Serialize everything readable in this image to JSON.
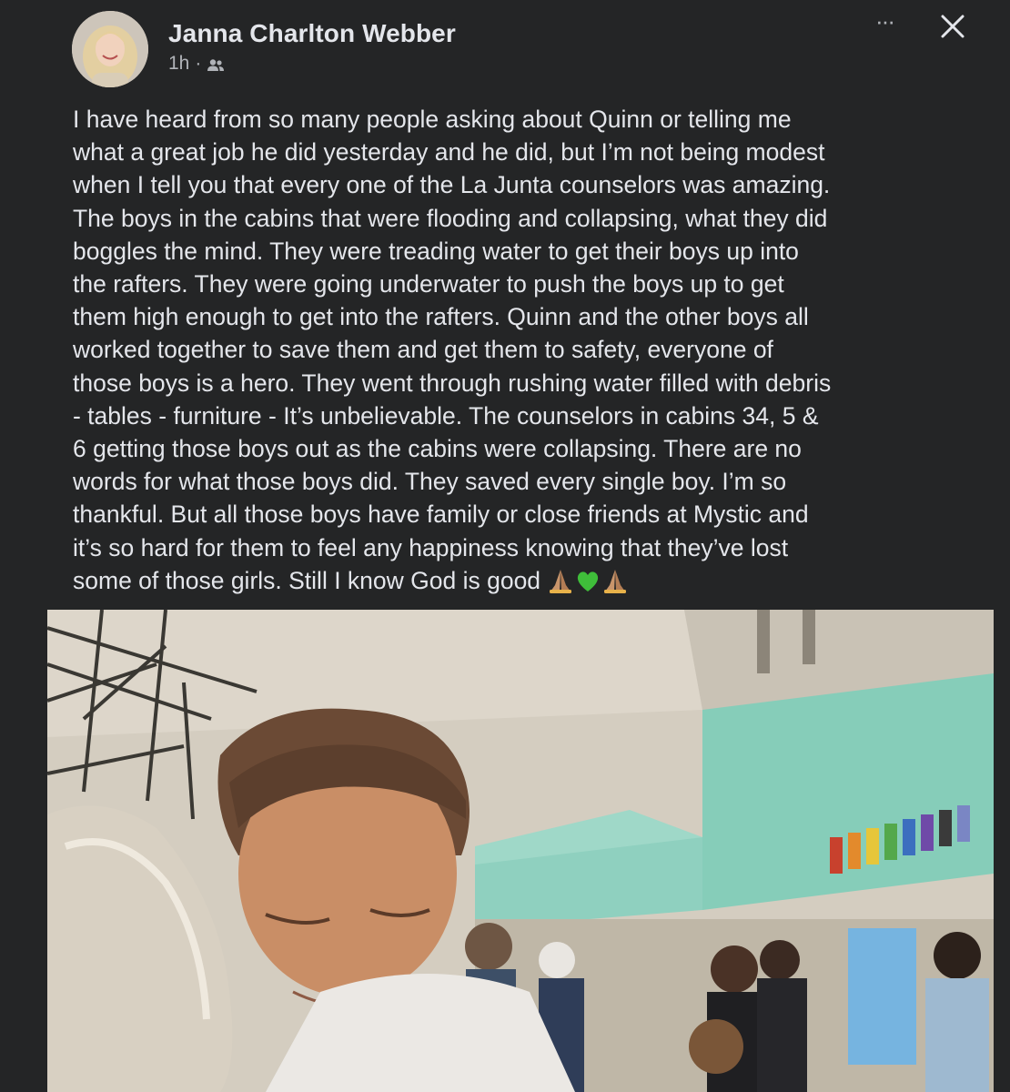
{
  "post": {
    "author": {
      "name": "Janna Charlton Webber",
      "avatar_icon": "profile-photo"
    },
    "meta": {
      "time": "1h",
      "separator": "·",
      "audience_icon": "friends-icon"
    },
    "actions": {
      "more_label": "···",
      "more_icon": "more-options-icon",
      "close_icon": "close-icon"
    },
    "text": "I have heard from so many people asking about Quinn or telling me\nwhat a great job he did yesterday and he did, but I’m not being modest\nwhen I tell you that every one of the La Junta counselors was amazing.\nThe boys in the cabins that were flooding and collapsing, what they did\nboggles the mind. They were treading water to get their boys up into\nthe rafters. They were going underwater to push the boys up to get\nthem high enough to get into the rafters. Quinn and the other boys all\nworked together to save them and get them to safety, everyone of\nthose boys is a hero. They went through rushing water filled with debris\n- tables - furniture - It’s unbelievable. The counselors in cabins 34, 5 &\n6 getting those boys out as the cabins were collapsing. There are no\nwords for what those boys did. They saved every single boy. I’m so\nthankful. But all those boys have family or close friends at Mystic and\nit’s so hard for them to feel any happiness knowing that they’ve lost\nsome of those girls. Still I know God is good",
    "emojis": [
      "folded-hands-icon",
      "green-heart-icon",
      "folded-hands-icon"
    ],
    "photo": {
      "content": "gymnasium-hug-photo",
      "colors": {
        "wall_upper": "#d6cfc3",
        "wall_teal": "#7fc9b6",
        "floor": "#b9a98c"
      }
    }
  }
}
